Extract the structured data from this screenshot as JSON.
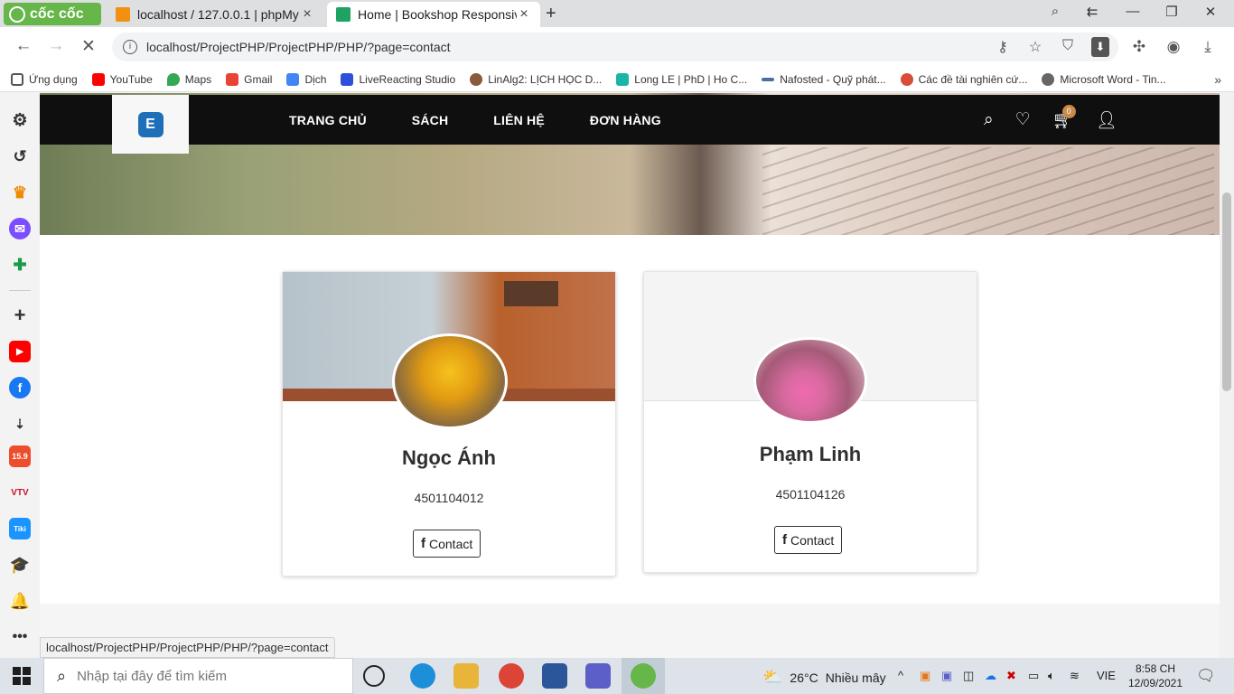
{
  "browser": {
    "brand": "cốc cốc",
    "tabs": [
      {
        "title": "localhost / 127.0.0.1 | phpMy",
        "favicon_color": "#f29111"
      },
      {
        "title": "Home | Bookshop Responsive",
        "favicon_color": "#1ea362"
      }
    ],
    "url": "localhost/ProjectPHP/ProjectPHP/PHP/?page=contact",
    "bookmarks": [
      {
        "label": "Ứng dụng",
        "color": "#555555"
      },
      {
        "label": "YouTube",
        "color": "#ff0000"
      },
      {
        "label": "Maps",
        "color": "#34a853"
      },
      {
        "label": "Gmail",
        "color": "#ea4335"
      },
      {
        "label": "Dịch",
        "color": "#4285f4"
      },
      {
        "label": "LiveReacting Studio",
        "color": "#2e4fd9"
      },
      {
        "label": "LinAlg2: LỊCH HỌC D...",
        "color": "#8a5a3c"
      },
      {
        "label": "Long LE | PhD | Ho C...",
        "color": "#1bb5a8"
      },
      {
        "label": "Nafosted - Quỹ phát...",
        "color": "#4a6fa5"
      },
      {
        "label": "Các đề tài nghiên cứ...",
        "color": "#d94c38"
      },
      {
        "label": "Microsoft Word - Tin...",
        "color": "#666666"
      }
    ]
  },
  "site": {
    "logo_letter": "E",
    "menu": [
      "TRANG CHỦ",
      "SÁCH",
      "LIÊN HỆ",
      "ĐƠN HÀNG"
    ],
    "cart_count": "0",
    "members": [
      {
        "name": "Ngọc Ánh",
        "id": "4501104012",
        "button": "Contact",
        "button_icon": "f"
      },
      {
        "name": "Phạm Linh",
        "id": "4501104126",
        "button": "Contact",
        "button_icon": "f"
      }
    ],
    "hover_url": "localhost/ProjectPHP/ProjectPHP/PHP/?page=contact"
  },
  "taskbar": {
    "search_placeholder": "Nhập tại đây để tìm kiếm",
    "temperature": "26°C",
    "weather": "Nhiều mây",
    "language": "VIE",
    "time": "8:58 CH",
    "date": "12/09/2021"
  }
}
